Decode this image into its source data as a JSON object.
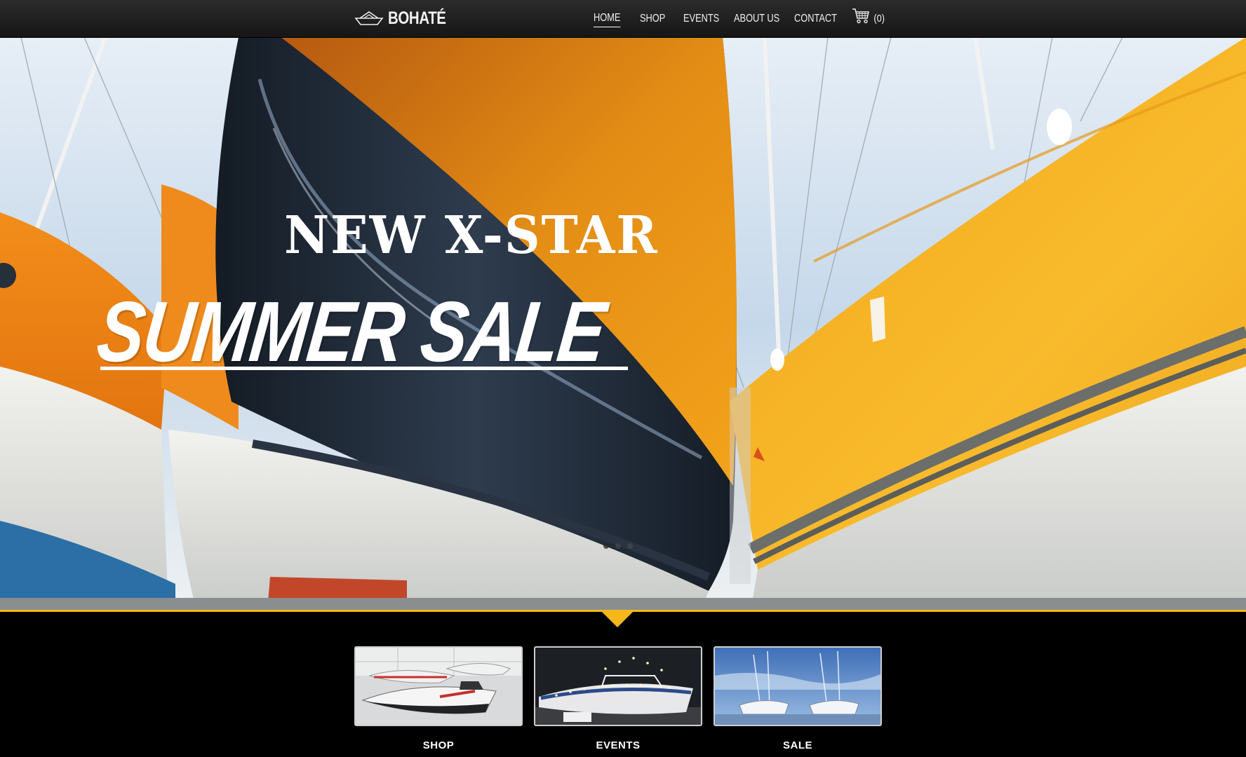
{
  "brand": {
    "name": "BOHATÉ",
    "logo_icon": "paper-boat-icon"
  },
  "nav": {
    "items": [
      {
        "label": "HOME",
        "active": true
      },
      {
        "label": "SHOP",
        "active": false
      },
      {
        "label": "EVENTS",
        "active": false
      },
      {
        "label": "ABOUT US",
        "active": false
      },
      {
        "label": "CONTACT",
        "active": false
      }
    ],
    "cart": {
      "icon": "shopping-cart-icon",
      "count": "(0)"
    }
  },
  "hero": {
    "line1": "NEW X-STAR",
    "line2": "SUMMER SALE",
    "slides": 3,
    "active_slide": 1
  },
  "tiles": [
    {
      "label": "SHOP"
    },
    {
      "label": "EVENTS"
    },
    {
      "label": "SALE"
    }
  ],
  "colors": {
    "accent": "#f4b71a",
    "navbar": "#1e1e1e",
    "background": "#000000",
    "hull_orange": "#e08a12",
    "cover_yellow": "#f6b321"
  }
}
